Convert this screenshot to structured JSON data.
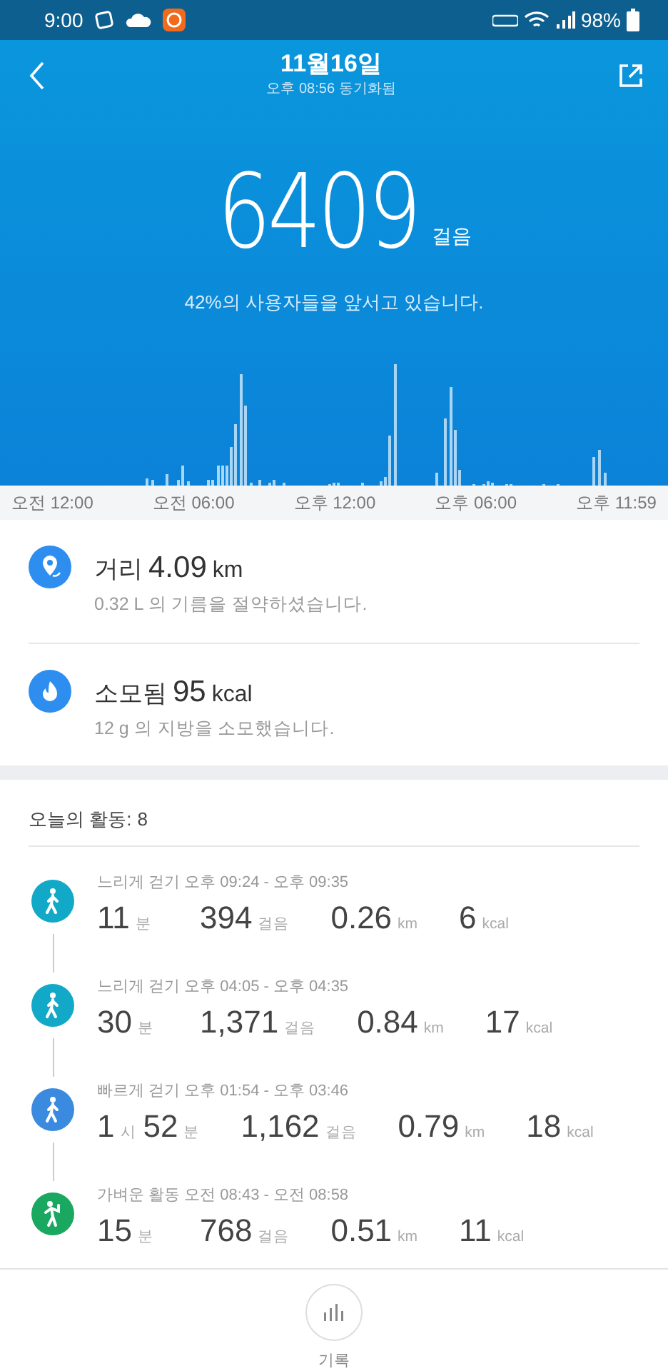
{
  "status_bar": {
    "time": "9:00",
    "battery": "98%"
  },
  "header": {
    "title": "11월16일",
    "subtitle": "오후 08:56 동기화됨"
  },
  "steps": {
    "value": "6409",
    "unit": "걸음",
    "rank": "42%의 사용자들을 앞서고 있습니다."
  },
  "chart_axis": [
    "오전 12:00",
    "오전 06:00",
    "오후 12:00",
    "오후 06:00",
    "오후 11:59"
  ],
  "stats": [
    {
      "kind": "distance",
      "label": "거리",
      "value": "4.09",
      "unit": "km",
      "note": "0.32 L 의 기름을 절약하셨습니다."
    },
    {
      "kind": "calories",
      "label": "소모됨",
      "value": "95",
      "unit": "kcal",
      "note": "12 g 의 지방을 소모했습니다."
    }
  ],
  "activities_header": {
    "label": "오늘의 활동:",
    "count": "8"
  },
  "activities": [
    {
      "kind": "walk",
      "color": "#12a9c9",
      "title": "느리게 걷기 오후 09:24 - 오후 09:35",
      "metrics": [
        [
          {
            "value": "11",
            "unit": "분"
          }
        ],
        [
          {
            "value": "394",
            "unit": "걸음"
          }
        ],
        [
          {
            "value": "0.26",
            "unit": "km"
          }
        ],
        [
          {
            "value": "6",
            "unit": "kcal"
          }
        ]
      ]
    },
    {
      "kind": "walk",
      "color": "#12a9c9",
      "title": "느리게 걷기 오후 04:05 - 오후 04:35",
      "metrics": [
        [
          {
            "value": "30",
            "unit": "분"
          }
        ],
        [
          {
            "value": "1,371",
            "unit": "걸음"
          }
        ],
        [
          {
            "value": "0.84",
            "unit": "km"
          }
        ],
        [
          {
            "value": "17",
            "unit": "kcal"
          }
        ]
      ]
    },
    {
      "kind": "walk",
      "color": "#3a8be0",
      "title": "빠르게 걷기 오후 01:54 - 오후 03:46",
      "metrics": [
        [
          {
            "value": "1",
            "unit": "시"
          },
          {
            "value": "52",
            "unit": "분"
          }
        ],
        [
          {
            "value": "1,162",
            "unit": "걸음"
          }
        ],
        [
          {
            "value": "0.79",
            "unit": "km"
          }
        ],
        [
          {
            "value": "18",
            "unit": "kcal"
          }
        ]
      ]
    },
    {
      "kind": "light",
      "color": "#1aa760",
      "title": "가벼운 활동 오전 08:43 - 오전 08:58",
      "metrics": [
        [
          {
            "value": "15",
            "unit": "분"
          }
        ],
        [
          {
            "value": "768",
            "unit": "걸음"
          }
        ],
        [
          {
            "value": "0.51",
            "unit": "km"
          }
        ],
        [
          {
            "value": "11",
            "unit": "kcal"
          }
        ]
      ]
    }
  ],
  "bottom_nav": {
    "label": "기록"
  }
}
